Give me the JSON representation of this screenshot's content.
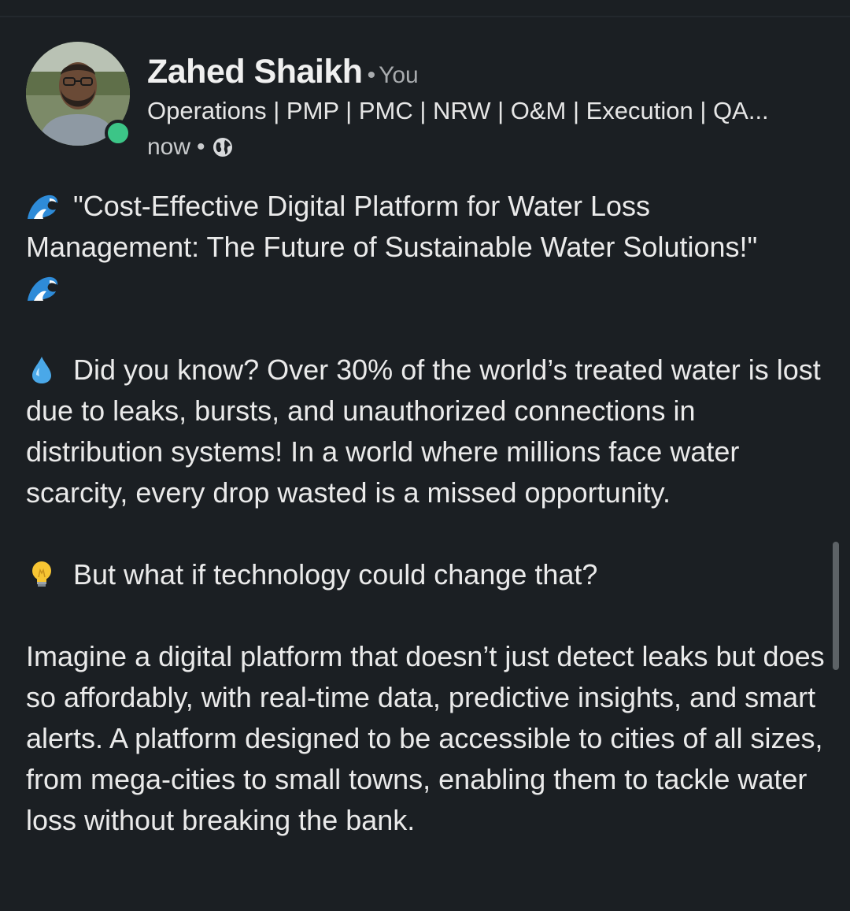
{
  "author": {
    "name": "Zahed Shaikh",
    "separator": "•",
    "relation": "You",
    "headline": "Operations | PMP | PMC | NRW | O&M | Execution | QA...",
    "timestamp": "now",
    "meta_separator": "•",
    "visibility_icon": "globe-icon",
    "online_status_color": "#3cc587"
  },
  "post": {
    "title_emoji_start": "wave-emoji",
    "title": "\"Cost-Effective Digital Platform for Water Loss Management: The Future of Sustainable Water Solutions!\"",
    "title_emoji_end": "wave-emoji",
    "droplet_emoji": "droplet-emoji",
    "paragraph_1": "Did you know? Over 30% of the world’s treated water is lost due to leaks, bursts, and unauthorized connections in distribution systems! In a world where millions face water scarcity, every drop wasted is a missed opportunity.",
    "bulb_emoji": "lightbulb-emoji",
    "paragraph_2": "But what if technology could change that?",
    "paragraph_3": "Imagine a digital platform that doesn’t just detect leaks but does so affordably, with real-time data, predictive insights, and smart alerts. A platform designed to be accessible to cities of all sizes, from mega-cities to small towns, enabling them to tackle water loss without breaking the bank."
  }
}
